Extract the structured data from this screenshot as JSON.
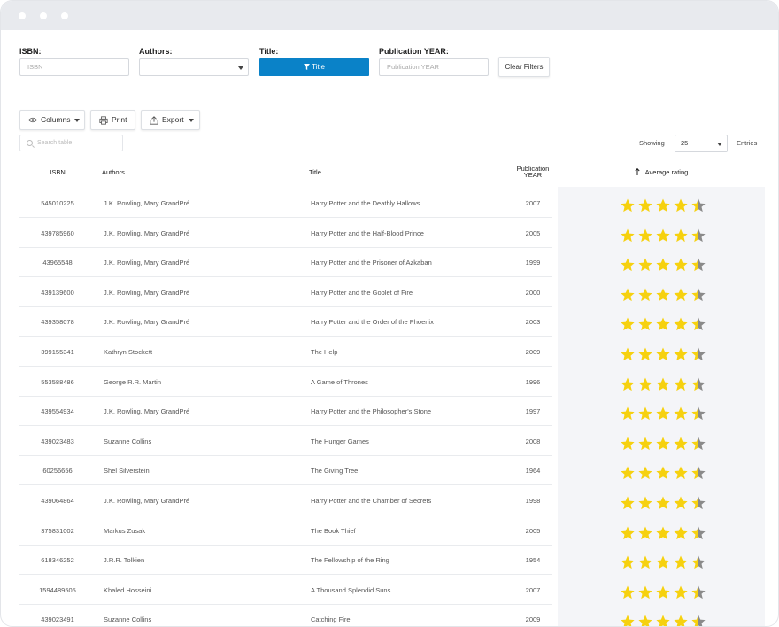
{
  "filters": {
    "isbn_label": "ISBN:",
    "isbn_placeholder": "ISBN",
    "authors_label": "Authors:",
    "title_label": "Title:",
    "title_button": "Title",
    "year_label": "Publication YEAR:",
    "year_placeholder": "Publication YEAR",
    "clear_label": "Clear Filters"
  },
  "toolbar": {
    "columns_label": "Columns",
    "print_label": "Print",
    "export_label": "Export",
    "search_placeholder": "Search table",
    "showing_label": "Showing",
    "page_size": "25",
    "entries_label": "Entries"
  },
  "table": {
    "headers": {
      "isbn": "ISBN",
      "authors": "Authors",
      "title": "Title",
      "year_line1": "Publication",
      "year_line2": "YEAR",
      "rating": "Average rating",
      "rating_sort_icon": "arrow-up-icon"
    },
    "star_colors": {
      "filled": "#f6d10f",
      "empty": "#8a8a8a"
    },
    "rows": [
      {
        "isbn": "545010225",
        "authors": "J.K. Rowling, Mary GrandPré",
        "title": "Harry Potter and the Deathly Hallows",
        "year": "2007",
        "rating": 4.5
      },
      {
        "isbn": "439785960",
        "authors": "J.K. Rowling, Mary GrandPré",
        "title": "Harry Potter and the Half-Blood Prince",
        "year": "2005",
        "rating": 4.5
      },
      {
        "isbn": "43965548",
        "authors": "J.K. Rowling, Mary GrandPré",
        "title": "Harry Potter and the Prisoner of Azkaban",
        "year": "1999",
        "rating": 4.5
      },
      {
        "isbn": "439139600",
        "authors": "J.K. Rowling, Mary GrandPré",
        "title": "Harry Potter and the Goblet of Fire",
        "year": "2000",
        "rating": 4.5
      },
      {
        "isbn": "439358078",
        "authors": "J.K. Rowling, Mary GrandPré",
        "title": "Harry Potter and the Order of the Phoenix",
        "year": "2003",
        "rating": 4.5
      },
      {
        "isbn": "399155341",
        "authors": "Kathryn Stockett",
        "title": "The Help",
        "year": "2009",
        "rating": 4.5
      },
      {
        "isbn": "553588486",
        "authors": "George R.R. Martin",
        "title": "A Game of Thrones",
        "year": "1996",
        "rating": 4.5
      },
      {
        "isbn": "439554934",
        "authors": "J.K. Rowling, Mary GrandPré",
        "title": "Harry Potter and the Philosopher's Stone",
        "year": "1997",
        "rating": 4.5
      },
      {
        "isbn": "439023483",
        "authors": "Suzanne Collins",
        "title": "The Hunger Games",
        "year": "2008",
        "rating": 4.5
      },
      {
        "isbn": "60256656",
        "authors": "Shel Silverstein",
        "title": "The Giving Tree",
        "year": "1964",
        "rating": 4.5
      },
      {
        "isbn": "439064864",
        "authors": "J.K. Rowling, Mary GrandPré",
        "title": "Harry Potter and the Chamber of Secrets",
        "year": "1998",
        "rating": 4.5
      },
      {
        "isbn": "375831002",
        "authors": "Markus Zusak",
        "title": "The Book Thief",
        "year": "2005",
        "rating": 4.5
      },
      {
        "isbn": "618346252",
        "authors": "J.R.R. Tolkien",
        "title": "The Fellowship of the Ring",
        "year": "1954",
        "rating": 4.5
      },
      {
        "isbn": "1594489505",
        "authors": "Khaled Hosseini",
        "title": "A Thousand Splendid Suns",
        "year": "2007",
        "rating": 4.5
      },
      {
        "isbn": "439023491",
        "authors": "Suzanne Collins",
        "title": "Catching Fire",
        "year": "2009",
        "rating": 4.5
      }
    ]
  }
}
